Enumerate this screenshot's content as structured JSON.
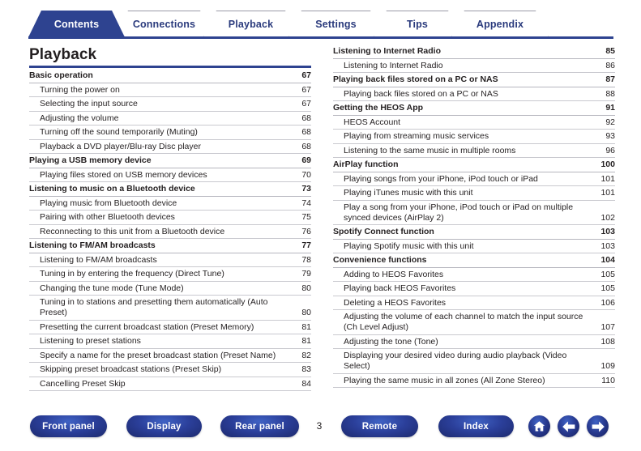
{
  "tabs": [
    {
      "label": "Contents",
      "active": true
    },
    {
      "label": "Connections",
      "active": false
    },
    {
      "label": "Playback",
      "active": false
    },
    {
      "label": "Settings",
      "active": false
    },
    {
      "label": "Tips",
      "active": false
    },
    {
      "label": "Appendix",
      "active": false
    }
  ],
  "page": {
    "title": "Playback",
    "number": "3"
  },
  "toc": {
    "left_column": [
      {
        "level": 1,
        "label": "Basic operation",
        "page": "67"
      },
      {
        "level": 2,
        "label": "Turning the power on",
        "page": "67"
      },
      {
        "level": 2,
        "label": "Selecting the input source",
        "page": "67"
      },
      {
        "level": 2,
        "label": "Adjusting the volume",
        "page": "68"
      },
      {
        "level": 2,
        "label": "Turning off the sound temporarily (Muting)",
        "page": "68"
      },
      {
        "level": 2,
        "label": "Playback a DVD player/Blu-ray Disc player",
        "page": "68"
      },
      {
        "level": 1,
        "label": "Playing a USB memory device",
        "page": "69"
      },
      {
        "level": 2,
        "label": "Playing files stored on USB memory devices",
        "page": "70"
      },
      {
        "level": 1,
        "label": "Listening to music on a Bluetooth device",
        "page": "73"
      },
      {
        "level": 2,
        "label": "Playing music from Bluetooth device",
        "page": "74"
      },
      {
        "level": 2,
        "label": "Pairing with other Bluetooth devices",
        "page": "75"
      },
      {
        "level": 2,
        "label": "Reconnecting to this unit from a Bluetooth device",
        "page": "76"
      },
      {
        "level": 1,
        "label": "Listening to FM/AM broadcasts",
        "page": "77"
      },
      {
        "level": 2,
        "label": "Listening to FM/AM broadcasts",
        "page": "78"
      },
      {
        "level": 2,
        "label": "Tuning in by entering the frequency (Direct Tune)",
        "page": "79"
      },
      {
        "level": 2,
        "label": "Changing the tune mode (Tune Mode)",
        "page": "80"
      },
      {
        "level": 2,
        "label": "Tuning in to stations and presetting them automatically (Auto Preset)",
        "page": "80"
      },
      {
        "level": 2,
        "label": "Presetting the current broadcast station (Preset Memory)",
        "page": "81"
      },
      {
        "level": 2,
        "label": "Listening to preset stations",
        "page": "81"
      },
      {
        "level": 2,
        "label": "Specify a name for the preset broadcast station (Preset Name)",
        "page": "82"
      },
      {
        "level": 2,
        "label": "Skipping preset broadcast stations (Preset Skip)",
        "page": "83"
      },
      {
        "level": 2,
        "label": "Cancelling Preset Skip",
        "page": "84"
      }
    ],
    "right_column": [
      {
        "level": 1,
        "label": "Listening to Internet Radio",
        "page": "85"
      },
      {
        "level": 2,
        "label": "Listening to Internet Radio",
        "page": "86"
      },
      {
        "level": 1,
        "label": "Playing back files stored on a PC or NAS",
        "page": "87"
      },
      {
        "level": 2,
        "label": "Playing back files stored on a PC or NAS",
        "page": "88"
      },
      {
        "level": 1,
        "label": "Getting the HEOS App",
        "page": "91"
      },
      {
        "level": 2,
        "label": "HEOS Account",
        "page": "92"
      },
      {
        "level": 2,
        "label": "Playing from streaming music services",
        "page": "93"
      },
      {
        "level": 2,
        "label": "Listening to the same music in multiple rooms",
        "page": "96"
      },
      {
        "level": 1,
        "label": "AirPlay function",
        "page": "100"
      },
      {
        "level": 2,
        "label": "Playing songs from your iPhone, iPod touch or iPad",
        "page": "101"
      },
      {
        "level": 2,
        "label": "Playing iTunes music with this unit",
        "page": "101"
      },
      {
        "level": 2,
        "label": "Play a song from your iPhone, iPod touch or iPad on multiple synced devices (AirPlay 2)",
        "page": "102"
      },
      {
        "level": 1,
        "label": "Spotify Connect function",
        "page": "103"
      },
      {
        "level": 2,
        "label": "Playing Spotify music with this unit",
        "page": "103"
      },
      {
        "level": 1,
        "label": "Convenience functions",
        "page": "104"
      },
      {
        "level": 2,
        "label": "Adding to HEOS Favorites",
        "page": "105"
      },
      {
        "level": 2,
        "label": "Playing back HEOS Favorites",
        "page": "105"
      },
      {
        "level": 2,
        "label": "Deleting a HEOS Favorites",
        "page": "106"
      },
      {
        "level": 2,
        "label": "Adjusting the volume of each channel to match the input source (Ch Level Adjust)",
        "page": "107"
      },
      {
        "level": 2,
        "label": "Adjusting the tone (Tone)",
        "page": "108"
      },
      {
        "level": 2,
        "label": "Displaying your desired video during audio playback (Video Select)",
        "page": "109"
      },
      {
        "level": 2,
        "label": "Playing the same music in all zones (All Zone Stereo)",
        "page": "110"
      }
    ]
  },
  "footer": {
    "buttons": [
      {
        "label": "Front panel"
      },
      {
        "label": "Display"
      },
      {
        "label": "Rear panel"
      },
      {
        "label": "Remote"
      },
      {
        "label": "Index"
      }
    ],
    "icons": [
      {
        "name": "home-icon"
      },
      {
        "name": "arrow-left-icon"
      },
      {
        "name": "arrow-right-icon"
      }
    ]
  },
  "colors": {
    "brand_blue": "#2e4390",
    "rule_gray": "#c9c9cf",
    "text": "#231f20"
  }
}
